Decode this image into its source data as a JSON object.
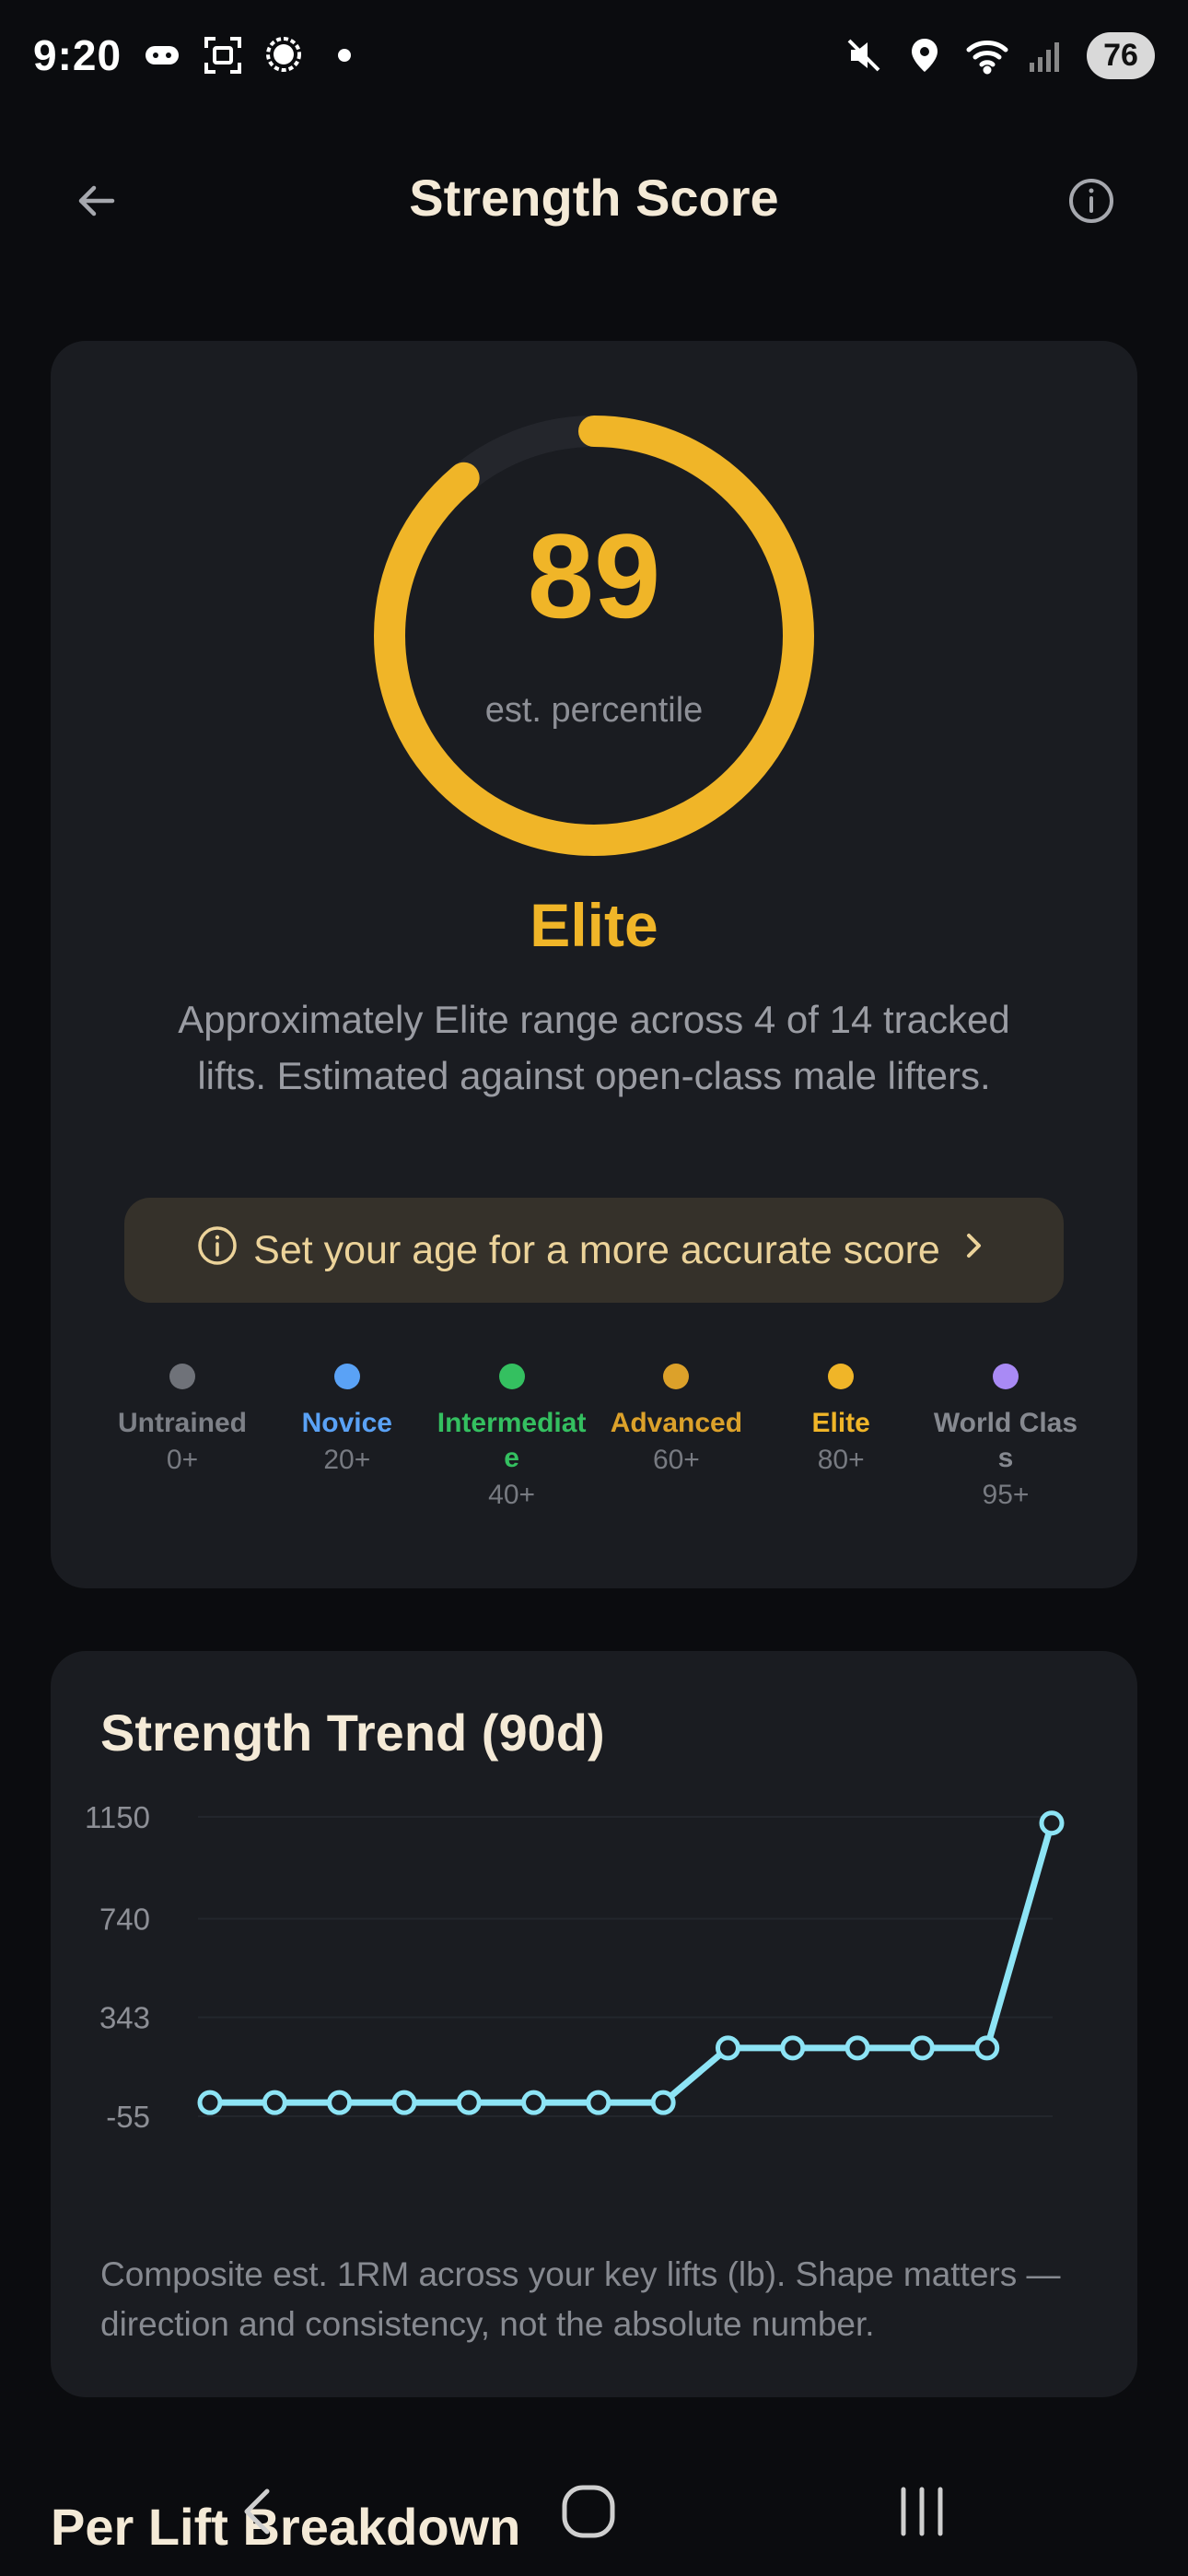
{
  "status_bar": {
    "time": "9:20",
    "battery": "76",
    "icons": [
      "gamepad-icon",
      "screenshot-icon",
      "chat-bubble-icon",
      "notification-dot-icon",
      "mute-icon",
      "location-icon",
      "wifi-icon",
      "signal-icon"
    ]
  },
  "header": {
    "title": "Strength Score",
    "back_icon": "back-arrow-icon",
    "info_icon": "info-icon"
  },
  "score": {
    "value": "89",
    "subtitle": "est. percentile",
    "tier": "Elite",
    "description": "Approximately Elite range across 4 of 14 tracked lifts. Estimated against open-class male lifters.",
    "gauge_fraction": 0.89,
    "accent_color": "#f0b528"
  },
  "age_banner": {
    "text": "Set your age for a more accurate score",
    "icon": "info-icon",
    "chevron": "chevron-right-icon"
  },
  "tiers": [
    {
      "name": "Untrained",
      "min": "0+",
      "color": "#6f7279"
    },
    {
      "name": "Novice",
      "min": "20+",
      "color": "#5aa2f6"
    },
    {
      "name": "Intermediate",
      "min": "40+",
      "color": "#34c060"
    },
    {
      "name": "Advanced",
      "min": "60+",
      "color": "#dca12a"
    },
    {
      "name": "Elite",
      "min": "80+",
      "color": "#f0b528"
    },
    {
      "name": "World Class",
      "min": "95+",
      "color": "#a98af5"
    }
  ],
  "trend": {
    "title": "Strength Trend (90d)",
    "note": "Composite est. 1RM across your key lifts (lb). Shape matters — direction and consistency, not the absolute number."
  },
  "chart_data": {
    "type": "line",
    "y_ticks": [
      "1150",
      "740",
      "343",
      "-55"
    ],
    "ylim": [
      -55,
      1150
    ],
    "values": [
      0,
      0,
      0,
      0,
      0,
      0,
      0,
      0,
      220,
      220,
      220,
      220,
      220,
      1125
    ],
    "line_color": "#8de4f5",
    "grid": true
  },
  "section": {
    "title": "Per Lift Breakdown"
  },
  "nav": {
    "back_icon": "nav-back-icon",
    "home_icon": "nav-home-icon",
    "recents_icon": "nav-recents-icon"
  }
}
